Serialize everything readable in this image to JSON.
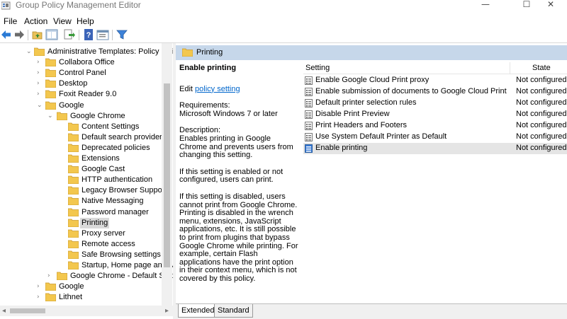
{
  "window": {
    "title": "Group Policy Management Editor",
    "minimize_glyph": "—",
    "maximize_glyph": "☐",
    "close_glyph": "✕"
  },
  "menu": [
    "File",
    "Action",
    "View",
    "Help"
  ],
  "toolbar": {
    "icons": [
      "back-icon",
      "forward-icon",
      "up-folder-icon",
      "show-hide-tree-icon",
      "export-list-icon",
      "help-icon",
      "properties-icon",
      "filter-icon"
    ]
  },
  "tree": {
    "items": [
      {
        "label": "Administrative Templates: Policy defir",
        "expander": "⌄",
        "level": 0
      },
      {
        "label": "Collabora Office",
        "expander": "›",
        "level": 1
      },
      {
        "label": "Control Panel",
        "expander": "›",
        "level": 1
      },
      {
        "label": "Desktop",
        "expander": "›",
        "level": 1
      },
      {
        "label": "Foxit Reader 9.0",
        "expander": "›",
        "level": 1
      },
      {
        "label": "Google",
        "expander": "⌄",
        "level": 1
      },
      {
        "label": "Google Chrome",
        "expander": "⌄",
        "level": 2
      },
      {
        "label": "Content Settings",
        "expander": "",
        "level": 3
      },
      {
        "label": "Default search provider",
        "expander": "",
        "level": 3
      },
      {
        "label": "Deprecated policies",
        "expander": "",
        "level": 3
      },
      {
        "label": "Extensions",
        "expander": "",
        "level": 3
      },
      {
        "label": "Google Cast",
        "expander": "",
        "level": 3
      },
      {
        "label": "HTTP authentication",
        "expander": "",
        "level": 3
      },
      {
        "label": "Legacy Browser Support",
        "expander": "",
        "level": 3
      },
      {
        "label": "Native Messaging",
        "expander": "",
        "level": 3
      },
      {
        "label": "Password manager",
        "expander": "",
        "level": 3
      },
      {
        "label": "Printing",
        "expander": "",
        "level": 3,
        "selected": true
      },
      {
        "label": "Proxy server",
        "expander": "",
        "level": 3
      },
      {
        "label": "Remote access",
        "expander": "",
        "level": 3
      },
      {
        "label": "Safe Browsing settings",
        "expander": "",
        "level": 3
      },
      {
        "label": "Startup, Home page and N",
        "expander": "",
        "level": 3
      },
      {
        "label": "Google Chrome - Default Sett",
        "expander": "›",
        "level": 2
      },
      {
        "label": "Google",
        "expander": "›",
        "level": 1
      },
      {
        "label": "Lithnet",
        "expander": "›",
        "level": 1
      }
    ],
    "hscroll_left": "◂",
    "hscroll_right": "▸"
  },
  "panel": {
    "header": "Printing",
    "description": {
      "title": "Enable printing",
      "edit_prefix": "Edit ",
      "edit_link": "policy setting",
      "requirements_label": "Requirements:",
      "requirements_value": "Microsoft Windows 7 or later",
      "description_label": "Description:",
      "description_text": "Enables printing in Google Chrome and prevents users from changing this setting.",
      "para_enabled": "If this setting is enabled or not configured, users can print.",
      "para_disabled": "If this setting is disabled, users cannot print from Google Chrome. Printing is disabled in the wrench menu, extensions, JavaScript applications, etc. It is still possible to print from plugins that bypass Google Chrome while printing. For example, certain Flash applications have the print option in their context menu, which is not covered by this policy."
    },
    "columns": {
      "setting": "Setting",
      "state": "State"
    },
    "rows": [
      {
        "name": "Enable Google Cloud Print proxy",
        "state": "Not configured"
      },
      {
        "name": "Enable submission of documents to Google Cloud Print",
        "state": "Not configured"
      },
      {
        "name": "Default printer selection rules",
        "state": "Not configured"
      },
      {
        "name": "Disable Print Preview",
        "state": "Not configured"
      },
      {
        "name": "Print Headers and Footers",
        "state": "Not configured"
      },
      {
        "name": "Use System Default Printer as Default",
        "state": "Not configured"
      },
      {
        "name": "Enable printing",
        "state": "Not configured",
        "selected": true
      }
    ],
    "tabs": [
      "Extended",
      "Standard"
    ]
  },
  "colors": {
    "header_band": "#c6d7ea",
    "selection": "#e5e5e5",
    "link": "#0066cc",
    "folder": "#f3c74e"
  }
}
